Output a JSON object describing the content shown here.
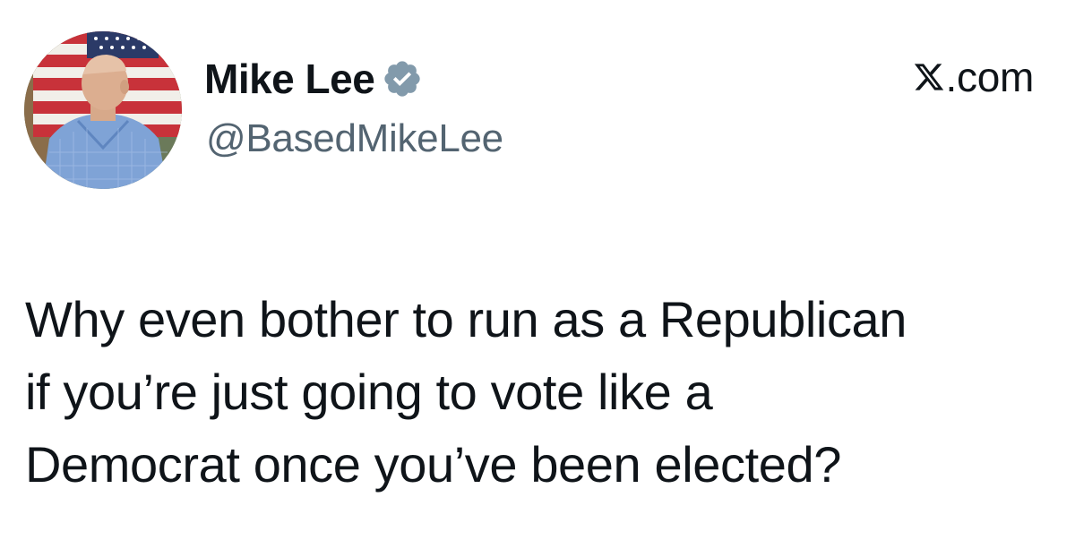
{
  "author": {
    "display_name": "Mike Lee",
    "handle": "@BasedMikeLee",
    "verified": true,
    "avatar_icon": "profile-photo-flag-background"
  },
  "source": {
    "label": "X.com",
    "logo_icon": "x-logo-icon",
    "rest": ".com"
  },
  "tweet": {
    "lines": [
      "Why even bother to run as a Republican",
      "if you’re just going to vote like a",
      "Democrat once you’ve been elected?"
    ]
  },
  "colors": {
    "text": "#0f1419",
    "handle": "#536471",
    "verified_badge": "#829aab"
  }
}
